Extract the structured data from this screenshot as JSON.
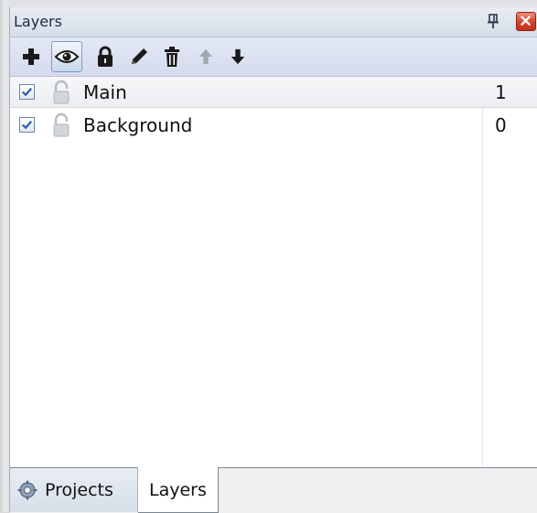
{
  "panel": {
    "title": "Layers"
  },
  "toolbar": {
    "buttons": [
      {
        "icon": "add-icon",
        "label": "Add"
      },
      {
        "icon": "eye-icon",
        "label": "Visibility",
        "active": true
      },
      {
        "icon": "lock-icon",
        "label": "Lock"
      },
      {
        "icon": "pencil-icon",
        "label": "Rename"
      },
      {
        "icon": "trash-icon",
        "label": "Delete"
      },
      {
        "icon": "arrow-up-icon",
        "label": "Move Up",
        "disabled": true
      },
      {
        "icon": "arrow-down-icon",
        "label": "Move Down"
      }
    ]
  },
  "layers": [
    {
      "name": "Main",
      "number": "1",
      "visible": true,
      "locked": false,
      "selected": true
    },
    {
      "name": "Background",
      "number": "0",
      "visible": true,
      "locked": false,
      "selected": false
    }
  ],
  "tabs": {
    "projects": "Projects",
    "layers": "Layers"
  },
  "colors": {
    "title_bg": "#dde3ec",
    "toolbar_bg": "#d8dfee",
    "close_red": "#d3422a",
    "check_blue": "#2f5fa8"
  }
}
